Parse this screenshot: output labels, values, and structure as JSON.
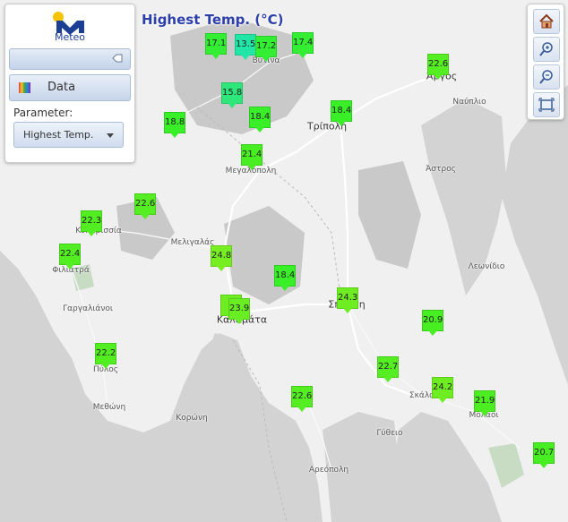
{
  "map": {
    "title": "Highest Temp. (°C)",
    "places": [
      {
        "name": "Βυτινα",
        "big": false
      },
      {
        "name": "Άργος",
        "big": true
      },
      {
        "name": "Ναύπλιο",
        "big": false
      },
      {
        "name": "Τρίπολη",
        "big": true
      },
      {
        "name": "Μεγαλόπολη",
        "big": false
      },
      {
        "name": "Άστρος",
        "big": false
      },
      {
        "name": "Κυπαρισσία",
        "big": false
      },
      {
        "name": "Μελιγαλάς",
        "big": false
      },
      {
        "name": "Φιλιατρά",
        "big": false
      },
      {
        "name": "Λεωνίδιο",
        "big": false
      },
      {
        "name": "Γαργαλιάνοι",
        "big": false
      },
      {
        "name": "Καλαμάτα",
        "big": true
      },
      {
        "name": "Σπάρτη",
        "big": true
      },
      {
        "name": "Πύλος",
        "big": false
      },
      {
        "name": "Σκάλα",
        "big": false
      },
      {
        "name": "Μεθώνη",
        "big": false
      },
      {
        "name": "Κορώνη",
        "big": false
      },
      {
        "name": "Μολάοι",
        "big": false
      },
      {
        "name": "Γύθειο",
        "big": false
      },
      {
        "name": "Αρεόπολη",
        "big": false
      }
    ],
    "markers": [
      {
        "value": "17.1",
        "color": "#33ee33"
      },
      {
        "value": "13.5",
        "color": "#22e6a5"
      },
      {
        "value": "17.2",
        "color": "#33ee33"
      },
      {
        "value": "17.4",
        "color": "#33ee33"
      },
      {
        "value": "22.6",
        "color": "#55ee22"
      },
      {
        "value": "15.8",
        "color": "#2ee67a"
      },
      {
        "value": "18.8",
        "color": "#38ef28"
      },
      {
        "value": "18.4",
        "color": "#38ef28"
      },
      {
        "value": "18.4",
        "color": "#38ef28"
      },
      {
        "value": "21.4",
        "color": "#48ee22"
      },
      {
        "value": "22.6",
        "color": "#55ee22"
      },
      {
        "value": "22.3",
        "color": "#52ee22"
      },
      {
        "value": "22.4",
        "color": "#52ee22"
      },
      {
        "value": "24.8",
        "color": "#77ee22"
      },
      {
        "value": "18.4",
        "color": "#38ef28"
      },
      {
        "value": "24.3",
        "color": "#6eee22"
      },
      {
        "value": "2",
        "color": "#6eee22"
      },
      {
        "value": "23.9",
        "color": "#68ee22"
      },
      {
        "value": "20.9",
        "color": "#46ee22"
      },
      {
        "value": "22.2",
        "color": "#52ee22"
      },
      {
        "value": "22.7",
        "color": "#55ee22"
      },
      {
        "value": "24.2",
        "color": "#6eee22"
      },
      {
        "value": "21.9",
        "color": "#4cee22"
      },
      {
        "value": "22.6",
        "color": "#55ee22"
      },
      {
        "value": "20.7",
        "color": "#46ee22"
      }
    ]
  },
  "panel": {
    "logo_text": "Meteo",
    "data_label": "Data",
    "parameter_label": "Parameter:",
    "parameter_value": "Highest Temp."
  },
  "toolbar": {
    "buttons": [
      "home-icon",
      "zoom-in-icon",
      "zoom-out-icon",
      "zoom-extent-icon"
    ]
  }
}
